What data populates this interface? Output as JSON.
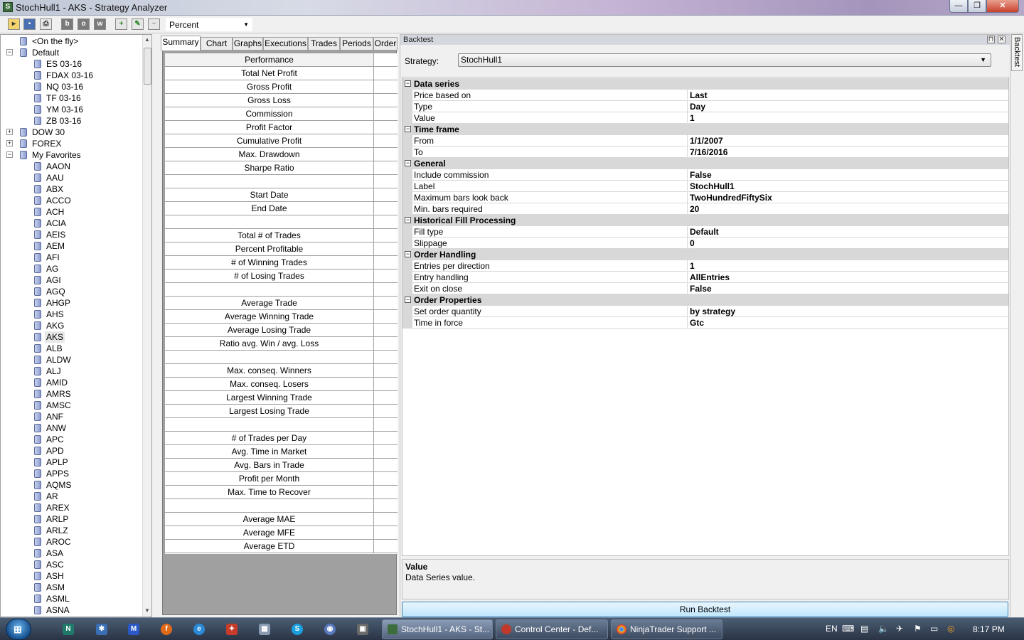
{
  "window": {
    "title": "StochHull1 - AKS - Strategy Analyzer",
    "min": "—",
    "max": "❐",
    "close": "✕"
  },
  "toolbar": {
    "percent_value": "Percent"
  },
  "tree": {
    "items": [
      {
        "label": "<On the fly>",
        "level": 1,
        "expander": ""
      },
      {
        "label": "Default",
        "level": 0,
        "expander": "−"
      },
      {
        "label": "ES 03-16",
        "level": 2,
        "expander": ""
      },
      {
        "label": "FDAX 03-16",
        "level": 2,
        "expander": ""
      },
      {
        "label": "NQ 03-16",
        "level": 2,
        "expander": ""
      },
      {
        "label": "TF 03-16",
        "level": 2,
        "expander": ""
      },
      {
        "label": "YM 03-16",
        "level": 2,
        "expander": ""
      },
      {
        "label": "ZB 03-16",
        "level": 2,
        "expander": ""
      },
      {
        "label": "DOW 30",
        "level": 0,
        "expander": "+"
      },
      {
        "label": "FOREX",
        "level": 0,
        "expander": "+"
      },
      {
        "label": "My Favorites",
        "level": 0,
        "expander": "−"
      },
      {
        "label": "AAON",
        "level": 2,
        "expander": ""
      },
      {
        "label": "AAU",
        "level": 2,
        "expander": ""
      },
      {
        "label": "ABX",
        "level": 2,
        "expander": ""
      },
      {
        "label": "ACCO",
        "level": 2,
        "expander": ""
      },
      {
        "label": "ACH",
        "level": 2,
        "expander": ""
      },
      {
        "label": "ACIA",
        "level": 2,
        "expander": ""
      },
      {
        "label": "AEIS",
        "level": 2,
        "expander": ""
      },
      {
        "label": "AEM",
        "level": 2,
        "expander": ""
      },
      {
        "label": "AFI",
        "level": 2,
        "expander": ""
      },
      {
        "label": "AG",
        "level": 2,
        "expander": ""
      },
      {
        "label": "AGI",
        "level": 2,
        "expander": ""
      },
      {
        "label": "AGQ",
        "level": 2,
        "expander": ""
      },
      {
        "label": "AHGP",
        "level": 2,
        "expander": ""
      },
      {
        "label": "AHS",
        "level": 2,
        "expander": ""
      },
      {
        "label": "AKG",
        "level": 2,
        "expander": ""
      },
      {
        "label": "AKS",
        "level": 2,
        "expander": "",
        "selected": true
      },
      {
        "label": "ALB",
        "level": 2,
        "expander": ""
      },
      {
        "label": "ALDW",
        "level": 2,
        "expander": ""
      },
      {
        "label": "ALJ",
        "level": 2,
        "expander": ""
      },
      {
        "label": "AMID",
        "level": 2,
        "expander": ""
      },
      {
        "label": "AMRS",
        "level": 2,
        "expander": ""
      },
      {
        "label": "AMSC",
        "level": 2,
        "expander": ""
      },
      {
        "label": "ANF",
        "level": 2,
        "expander": ""
      },
      {
        "label": "ANW",
        "level": 2,
        "expander": ""
      },
      {
        "label": "APC",
        "level": 2,
        "expander": ""
      },
      {
        "label": "APD",
        "level": 2,
        "expander": ""
      },
      {
        "label": "APLP",
        "level": 2,
        "expander": ""
      },
      {
        "label": "APPS",
        "level": 2,
        "expander": ""
      },
      {
        "label": "AQMS",
        "level": 2,
        "expander": ""
      },
      {
        "label": "AR",
        "level": 2,
        "expander": ""
      },
      {
        "label": "AREX",
        "level": 2,
        "expander": ""
      },
      {
        "label": "ARLP",
        "level": 2,
        "expander": ""
      },
      {
        "label": "ARLZ",
        "level": 2,
        "expander": ""
      },
      {
        "label": "AROC",
        "level": 2,
        "expander": ""
      },
      {
        "label": "ASA",
        "level": 2,
        "expander": ""
      },
      {
        "label": "ASC",
        "level": 2,
        "expander": ""
      },
      {
        "label": "ASH",
        "level": 2,
        "expander": ""
      },
      {
        "label": "ASM",
        "level": 2,
        "expander": ""
      },
      {
        "label": "ASML",
        "level": 2,
        "expander": ""
      },
      {
        "label": "ASNA",
        "level": 2,
        "expander": ""
      }
    ]
  },
  "tabs": [
    "Summary",
    "Chart",
    "Graphs",
    "Executions",
    "Trades",
    "Periods",
    "Order"
  ],
  "summary": {
    "rows": [
      "Performance",
      "Total Net Profit",
      "Gross Profit",
      "Gross Loss",
      "Commission",
      "Profit Factor",
      "Cumulative Profit",
      "Max. Drawdown",
      "Sharpe Ratio",
      "",
      "Start Date",
      "End Date",
      "",
      "Total # of Trades",
      "Percent Profitable",
      "# of Winning Trades",
      "# of Losing Trades",
      "",
      "Average Trade",
      "Average Winning Trade",
      "Average Losing Trade",
      "Ratio avg. Win / avg. Loss",
      "",
      "Max. conseq. Winners",
      "Max. conseq. Losers",
      "Largest Winning Trade",
      "Largest Losing Trade",
      "",
      "# of Trades per Day",
      "Avg. Time in Market",
      "Avg. Bars in Trade",
      "Profit per Month",
      "Max. Time to Recover",
      "",
      "Average MAE",
      "Average MFE",
      "Average ETD"
    ]
  },
  "backtest": {
    "panel_title": "Backtest",
    "side_tab": "Backtest",
    "strategy_label": "Strategy:",
    "strategy_value": "StochHull1",
    "grid": [
      {
        "cat": "Data series"
      },
      {
        "name": "Price based on",
        "value": "Last"
      },
      {
        "name": "Type",
        "value": "Day"
      },
      {
        "name": "Value",
        "value": "1"
      },
      {
        "cat": "Time frame"
      },
      {
        "name": "From",
        "value": "1/1/2007"
      },
      {
        "name": "To",
        "value": "7/16/2016"
      },
      {
        "cat": "General"
      },
      {
        "name": "Include commission",
        "value": "False"
      },
      {
        "name": "Label",
        "value": "StochHull1"
      },
      {
        "name": "Maximum bars look back",
        "value": "TwoHundredFiftySix"
      },
      {
        "name": "Min. bars required",
        "value": "20"
      },
      {
        "cat": "Historical Fill Processing"
      },
      {
        "name": "Fill type",
        "value": "Default"
      },
      {
        "name": "Slippage",
        "value": "0"
      },
      {
        "cat": "Order Handling"
      },
      {
        "name": "Entries per direction",
        "value": "1"
      },
      {
        "name": "Entry handling",
        "value": "AllEntries"
      },
      {
        "name": "Exit on close",
        "value": "False"
      },
      {
        "cat": "Order Properties"
      },
      {
        "name": "Set order quantity",
        "value": "by strategy"
      },
      {
        "name": "Time in force",
        "value": "Gtc"
      }
    ],
    "help_title": "Value",
    "help_desc": "Data Series value.",
    "run_label": "Run Backtest"
  },
  "taskbar": {
    "tasks": [
      {
        "label": "StochHull1 - AKS - St...",
        "active": true
      },
      {
        "label": "Control Center - Def...",
        "active": false
      },
      {
        "label": "NinjaTrader Support ...",
        "active": false
      }
    ],
    "lang": "EN",
    "time": "8:17 PM"
  }
}
